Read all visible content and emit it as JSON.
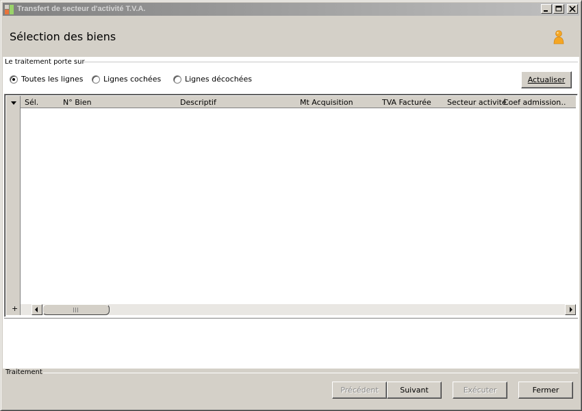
{
  "window": {
    "title": "Transfert de secteur d'activité T.V.A.",
    "controls": [
      "minimize",
      "maximize",
      "close"
    ]
  },
  "header": {
    "title": "Sélection des biens",
    "icon": "user-icon"
  },
  "filter": {
    "group_label": "Le traitement porte sur",
    "options": [
      {
        "label": "Toutes les lignes",
        "checked": true
      },
      {
        "label": "Lignes cochées",
        "checked": false
      },
      {
        "label": "Lignes décochées",
        "checked": false
      }
    ],
    "refresh_label": "Actualiser"
  },
  "grid": {
    "columns": [
      "Sél.",
      "N° Bien",
      "Descriptif",
      "Mt Acquisition",
      "TVA Facturée",
      "Secteur activité",
      "Coef admission",
      "..."
    ],
    "rows": [],
    "add_label": "+",
    "grip": "|||"
  },
  "footer": {
    "group_label": "Traitement",
    "buttons": {
      "previous": "Précédent",
      "next": "Suivant",
      "execute": "Exécuter",
      "close": "Fermer"
    }
  },
  "colors": {
    "background": "#d4d0c8",
    "titlebar_start": "#808080",
    "titlebar_end": "#c0c0c0",
    "disabled_text": "#8c8c8c",
    "user_icon": "#f5a623"
  }
}
